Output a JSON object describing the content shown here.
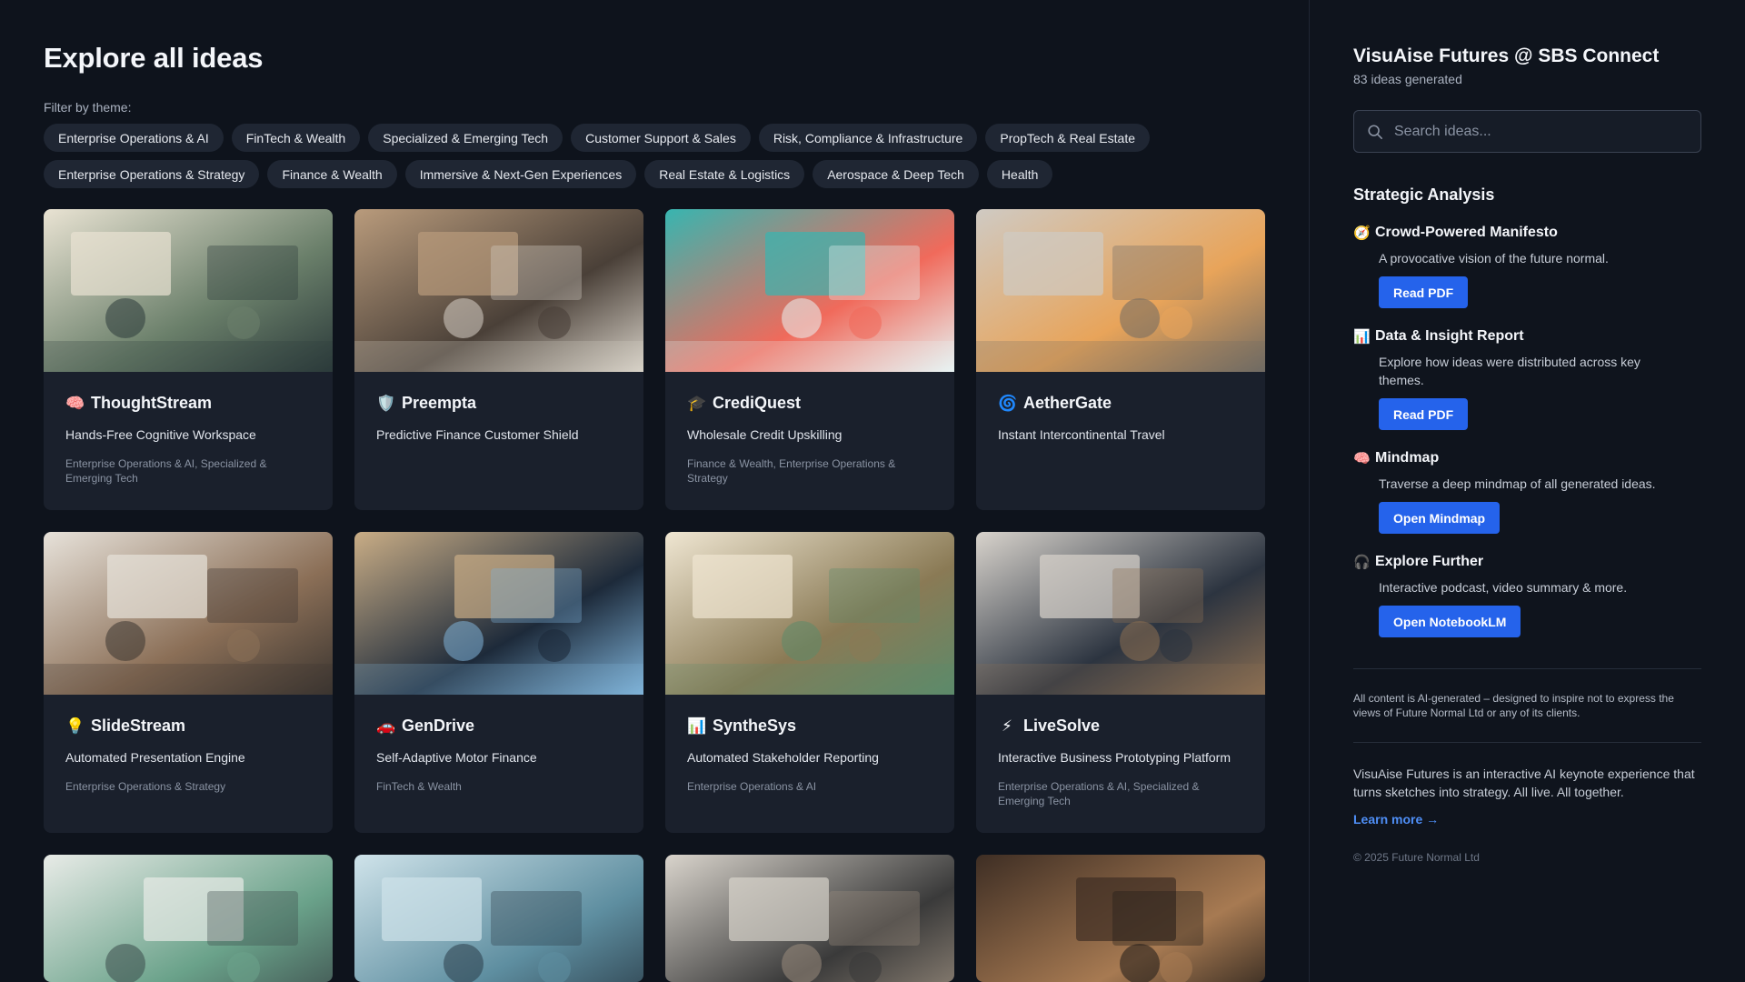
{
  "main": {
    "title": "Explore all ideas",
    "filter_label": "Filter by theme:",
    "themes": [
      "Enterprise Operations & AI",
      "FinTech & Wealth",
      "Specialized & Emerging Tech",
      "Customer Support & Sales",
      "Risk, Compliance & Infrastructure",
      "PropTech & Real Estate",
      "Enterprise Operations & Strategy",
      "Finance & Wealth",
      "Immersive & Next-Gen Experiences",
      "Real Estate & Logistics",
      "Aerospace & Deep Tech",
      "Health"
    ],
    "cards": [
      {
        "icon": "🧠",
        "icon_name": "brain-icon",
        "title": "ThoughtStream",
        "subtitle": "Hands-Free Cognitive Workspace",
        "tags": "Enterprise Operations & AI, Specialized & Emerging Tech",
        "image_palette": [
          "#e9e3d3",
          "#6a7f6a",
          "#2b3a3a"
        ]
      },
      {
        "icon": "🛡️",
        "icon_name": "shield-icon",
        "title": "Preempta",
        "subtitle": "Predictive Finance Customer Shield",
        "tags": "",
        "image_palette": [
          "#b99b7c",
          "#4a4038",
          "#d8d2c8"
        ]
      },
      {
        "icon": "🎓",
        "icon_name": "graduation-cap-icon",
        "title": "CrediQuest",
        "subtitle": "Wholesale Credit Upskilling",
        "tags": "Finance & Wealth, Enterprise Operations & Strategy",
        "image_palette": [
          "#37b5b0",
          "#f06a5b",
          "#e8f4f4"
        ]
      },
      {
        "icon": "🌀",
        "icon_name": "cyclone-icon",
        "title": "AetherGate",
        "subtitle": "Instant Intercontinental Travel",
        "tags": "",
        "image_palette": [
          "#cfcac3",
          "#e8a45a",
          "#6f6a63"
        ]
      },
      {
        "icon": "💡",
        "icon_name": "lightbulb-icon",
        "title": "SlideStream",
        "subtitle": "Automated Presentation Engine",
        "tags": "Enterprise Operations & Strategy",
        "image_palette": [
          "#e7e2da",
          "#8b6f57",
          "#3b3530"
        ]
      },
      {
        "icon": "🚗",
        "icon_name": "car-icon",
        "title": "GenDrive",
        "subtitle": "Self-Adaptive Motor Finance",
        "tags": "FinTech & Wealth",
        "image_palette": [
          "#c9ad86",
          "#1d2a3a",
          "#7fb3d9"
        ]
      },
      {
        "icon": "📊",
        "icon_name": "bar-chart-icon",
        "title": "SyntheSys",
        "subtitle": "Automated Stakeholder Reporting",
        "tags": "Enterprise Operations & AI",
        "image_palette": [
          "#efe6d2",
          "#8a7a55",
          "#5d8a6a"
        ]
      },
      {
        "icon": "⚡",
        "icon_name": "lightning-icon",
        "title": "LiveSolve",
        "subtitle": "Interactive Business Prototyping Platform",
        "tags": "Enterprise Operations & AI, Specialized & Emerging Tech",
        "image_palette": [
          "#d8d3cc",
          "#2c3440",
          "#8c6f52"
        ]
      },
      {
        "icon": "",
        "icon_name": "",
        "title": "",
        "subtitle": "",
        "tags": "",
        "image_palette": [
          "#e8ebe7",
          "#6aa28a",
          "#3b4a4a"
        ]
      },
      {
        "icon": "",
        "icon_name": "",
        "title": "",
        "subtitle": "",
        "tags": "",
        "image_palette": [
          "#cfe3ea",
          "#5e8ea0",
          "#2a3c48"
        ]
      },
      {
        "icon": "",
        "icon_name": "",
        "title": "",
        "subtitle": "",
        "tags": "",
        "image_palette": [
          "#d9d4cc",
          "#3a3a3a",
          "#9a8d7e"
        ]
      },
      {
        "icon": "",
        "icon_name": "",
        "title": "",
        "subtitle": "",
        "tags": "",
        "image_palette": [
          "#3e2e24",
          "#a77a52",
          "#1e1a17"
        ]
      }
    ]
  },
  "sidebar": {
    "title": "VisuAise Futures @ SBS Connect",
    "count": "83 ideas generated",
    "search_placeholder": "Search ideas...",
    "section_title": "Strategic Analysis",
    "items": [
      {
        "icon": "🧭",
        "icon_name": "compass-icon",
        "title": "Crowd-Powered Manifesto",
        "desc": "A provocative vision of the future normal.",
        "button": "Read PDF"
      },
      {
        "icon": "📊",
        "icon_name": "bar-chart-icon",
        "title": "Data & Insight Report",
        "desc": "Explore how ideas were distributed across key themes.",
        "button": "Read PDF"
      },
      {
        "icon": "🧠",
        "icon_name": "brain-icon",
        "title": "Mindmap",
        "desc": "Traverse a deep mindmap of all generated ideas.",
        "button": "Open Mindmap"
      },
      {
        "icon": "🎧",
        "icon_name": "headphones-icon",
        "title": "Explore Further",
        "desc": "Interactive podcast, video summary & more.",
        "button": "Open NotebookLM"
      }
    ],
    "disclaimer": "All content is AI-generated – designed to inspire not to express the views of Future Normal Ltd or any of its clients.",
    "about": "VisuAise Futures is an interactive AI keynote experience that turns sketches into strategy. All live. All together.",
    "learn_more": "Learn more →",
    "copyright": "© 2025 Future Normal Ltd"
  }
}
